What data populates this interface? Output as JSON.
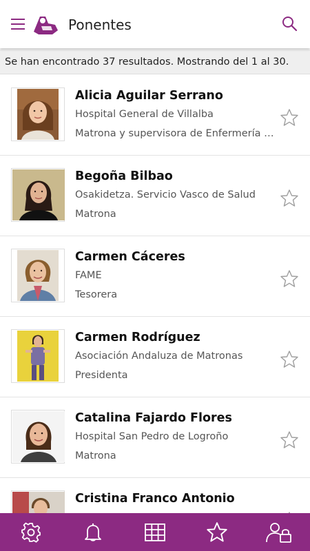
{
  "header": {
    "title": "Ponentes"
  },
  "results_text": "Se han encontrado 37 resultados. Mostrando del 1 al 30.",
  "colors": {
    "accent": "#8c2a82",
    "photo_bg_yellow": "#e9d23c"
  },
  "speakers": [
    {
      "name": "Alicia Aguilar Serrano",
      "org": "Hospital General de Villalba",
      "role": "Matrona y supervisora de Enfermería de Obstetricia"
    },
    {
      "name": "Begoña Bilbao",
      "org": "Osakidetza. Servicio Vasco de Salud",
      "role": "Matrona"
    },
    {
      "name": "Carmen Cáceres",
      "org": "FAME",
      "role": "Tesorera"
    },
    {
      "name": "Carmen Rodríguez",
      "org": "Asociación Andaluza de Matronas",
      "role": "Presidenta"
    },
    {
      "name": "Catalina Fajardo Flores",
      "org": "Hospital San Pedro de Logroño",
      "role": "Matrona"
    },
    {
      "name": "Cristina Franco Antonio",
      "org": "",
      "role": ""
    }
  ],
  "icons": {
    "menu": "hamburger-icon",
    "logo": "app-logo-icon",
    "search": "search-icon",
    "favorite": "star-outline-icon",
    "settings": "gear-icon",
    "notifications": "bell-icon",
    "schedule": "grid-icon",
    "favorites_tab": "star-icon",
    "profile": "user-lock-icon"
  }
}
